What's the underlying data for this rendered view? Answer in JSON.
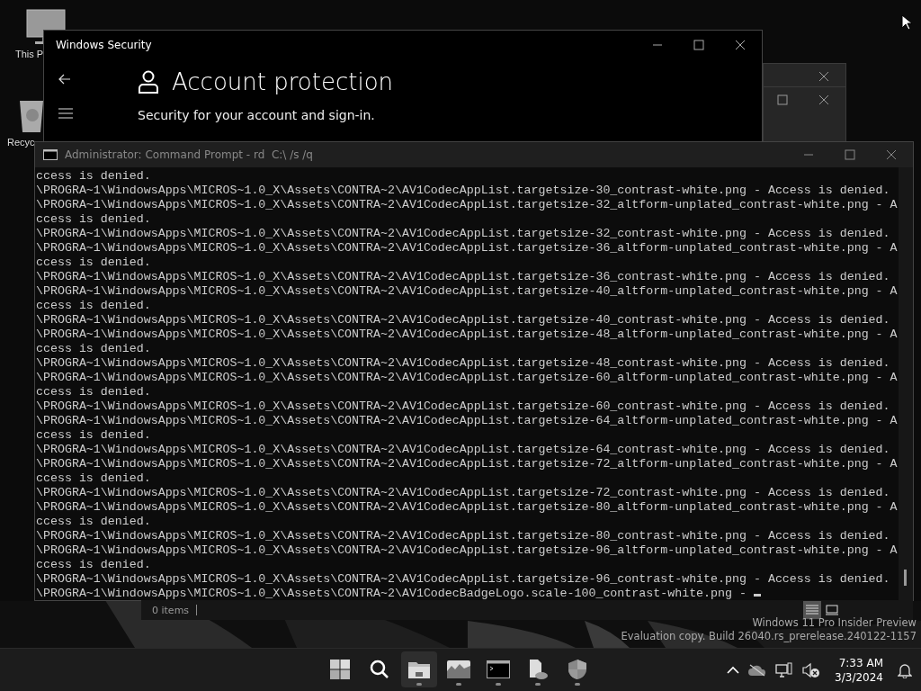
{
  "desktop_icons": [
    {
      "kind": "computer",
      "label": "This P"
    },
    {
      "kind": "recycle",
      "label": "Recyc"
    }
  ],
  "security_window": {
    "title": "Windows Security",
    "heading": "Account protection",
    "subtitle": "Security for your account and sign-in."
  },
  "console": {
    "title": "Administrator: Command Prompt - rd  C:\\ /s /q",
    "lines": [
      "ccess is denied.",
      "\\PROGRA~1\\WindowsApps\\MICROS~1.0_X\\Assets\\CONTRA~2\\AV1CodecAppList.targetsize-30_contrast-white.png - Access is denied.",
      "\\PROGRA~1\\WindowsApps\\MICROS~1.0_X\\Assets\\CONTRA~2\\AV1CodecAppList.targetsize-32_altform-unplated_contrast-white.png - A",
      "ccess is denied.",
      "\\PROGRA~1\\WindowsApps\\MICROS~1.0_X\\Assets\\CONTRA~2\\AV1CodecAppList.targetsize-32_contrast-white.png - Access is denied.",
      "\\PROGRA~1\\WindowsApps\\MICROS~1.0_X\\Assets\\CONTRA~2\\AV1CodecAppList.targetsize-36_altform-unplated_contrast-white.png - A",
      "ccess is denied.",
      "\\PROGRA~1\\WindowsApps\\MICROS~1.0_X\\Assets\\CONTRA~2\\AV1CodecAppList.targetsize-36_contrast-white.png - Access is denied.",
      "\\PROGRA~1\\WindowsApps\\MICROS~1.0_X\\Assets\\CONTRA~2\\AV1CodecAppList.targetsize-40_altform-unplated_contrast-white.png - A",
      "ccess is denied.",
      "\\PROGRA~1\\WindowsApps\\MICROS~1.0_X\\Assets\\CONTRA~2\\AV1CodecAppList.targetsize-40_contrast-white.png - Access is denied.",
      "\\PROGRA~1\\WindowsApps\\MICROS~1.0_X\\Assets\\CONTRA~2\\AV1CodecAppList.targetsize-48_altform-unplated_contrast-white.png - A",
      "ccess is denied.",
      "\\PROGRA~1\\WindowsApps\\MICROS~1.0_X\\Assets\\CONTRA~2\\AV1CodecAppList.targetsize-48_contrast-white.png - Access is denied.",
      "\\PROGRA~1\\WindowsApps\\MICROS~1.0_X\\Assets\\CONTRA~2\\AV1CodecAppList.targetsize-60_altform-unplated_contrast-white.png - A",
      "ccess is denied.",
      "\\PROGRA~1\\WindowsApps\\MICROS~1.0_X\\Assets\\CONTRA~2\\AV1CodecAppList.targetsize-60_contrast-white.png - Access is denied.",
      "\\PROGRA~1\\WindowsApps\\MICROS~1.0_X\\Assets\\CONTRA~2\\AV1CodecAppList.targetsize-64_altform-unplated_contrast-white.png - A",
      "ccess is denied.",
      "\\PROGRA~1\\WindowsApps\\MICROS~1.0_X\\Assets\\CONTRA~2\\AV1CodecAppList.targetsize-64_contrast-white.png - Access is denied.",
      "\\PROGRA~1\\WindowsApps\\MICROS~1.0_X\\Assets\\CONTRA~2\\AV1CodecAppList.targetsize-72_altform-unplated_contrast-white.png - A",
      "ccess is denied.",
      "\\PROGRA~1\\WindowsApps\\MICROS~1.0_X\\Assets\\CONTRA~2\\AV1CodecAppList.targetsize-72_contrast-white.png - Access is denied.",
      "\\PROGRA~1\\WindowsApps\\MICROS~1.0_X\\Assets\\CONTRA~2\\AV1CodecAppList.targetsize-80_altform-unplated_contrast-white.png - A",
      "ccess is denied.",
      "\\PROGRA~1\\WindowsApps\\MICROS~1.0_X\\Assets\\CONTRA~2\\AV1CodecAppList.targetsize-80_contrast-white.png - Access is denied.",
      "\\PROGRA~1\\WindowsApps\\MICROS~1.0_X\\Assets\\CONTRA~2\\AV1CodecAppList.targetsize-96_altform-unplated_contrast-white.png - A",
      "ccess is denied.",
      "\\PROGRA~1\\WindowsApps\\MICROS~1.0_X\\Assets\\CONTRA~2\\AV1CodecAppList.targetsize-96_contrast-white.png - Access is denied.",
      "\\PROGRA~1\\WindowsApps\\MICROS~1.0_X\\Assets\\CONTRA~2\\AV1CodecBadgeLogo.scale-100_contrast-white.png - "
    ]
  },
  "explorer_status": {
    "items": "0 items",
    "views": [
      {
        "kind": "details",
        "selected": true
      },
      {
        "kind": "tiles",
        "selected": false
      }
    ]
  },
  "os_watermark": [
    "Windows 11 Pro Insider Preview",
    "Evaluation copy. Build 26040.rs_prerelease.240122-1157"
  ],
  "taskbar": {
    "apps": [
      {
        "kind": "start",
        "selected": false,
        "running": false
      },
      {
        "kind": "search",
        "selected": false,
        "running": false
      },
      {
        "kind": "explorer",
        "selected": true,
        "running": true
      },
      {
        "kind": "photos",
        "selected": false,
        "running": true
      },
      {
        "kind": "terminal",
        "selected": false,
        "running": true
      },
      {
        "kind": "file",
        "selected": false,
        "running": true
      },
      {
        "kind": "shield",
        "selected": false,
        "running": true
      }
    ],
    "time": "7:33 AM",
    "date": "3/3/2024"
  }
}
